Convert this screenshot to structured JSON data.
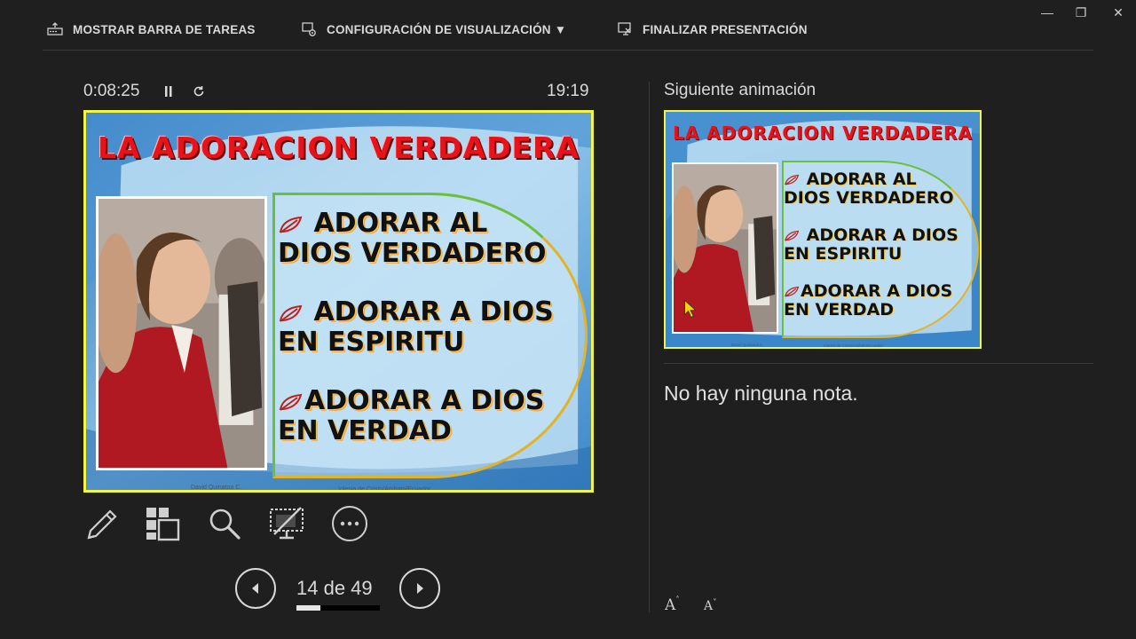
{
  "toolbar": {
    "show_taskbar": "MOSTRAR BARRA DE TAREAS",
    "display_settings": "CONFIGURACIÓN DE VISUALIZACIÓN ▼",
    "end_show": "FINALIZAR PRESENTACIÓN"
  },
  "timer": {
    "elapsed": "0:08:25",
    "clock": "19:19"
  },
  "current_slide": {
    "title": "LA ADORACION VERDADERA",
    "bullets": [
      {
        "line1": " ADORAR AL",
        "line2": "DIOS VERDADERO"
      },
      {
        "line1": " ADORAR A DIOS",
        "line2": "EN ESPIRITU"
      },
      {
        "line1": "ADORAR  A DIOS",
        "line2": "EN VERDAD"
      }
    ],
    "credit_left": "David Quinatoa C.",
    "credit_right": "Iglesia de Cristo/Ambato/Ecuador"
  },
  "next_slide": {
    "label": "Siguiente animación",
    "title": "LA ADORACION VERDADERA",
    "bullets": [
      {
        "line1": " ADORAR AL",
        "line2": "DIOS VERDADERO"
      },
      {
        "line1": " ADORAR A DIOS",
        "line2": "EN ESPIRITU"
      },
      {
        "line1": "ADORAR  A DIOS",
        "line2": "EN VERDAD"
      }
    ],
    "credit_left": "David Quinatoa C.",
    "credit_right": "Iglesia de Cristo/Ambato/Ecuador"
  },
  "notes": {
    "text": "No hay ninguna nota."
  },
  "navigation": {
    "counter": "14 de 49",
    "progress_fraction": 0.2857
  },
  "colors": {
    "slide_border": "#f4f442",
    "title_red": "#e8131a"
  }
}
